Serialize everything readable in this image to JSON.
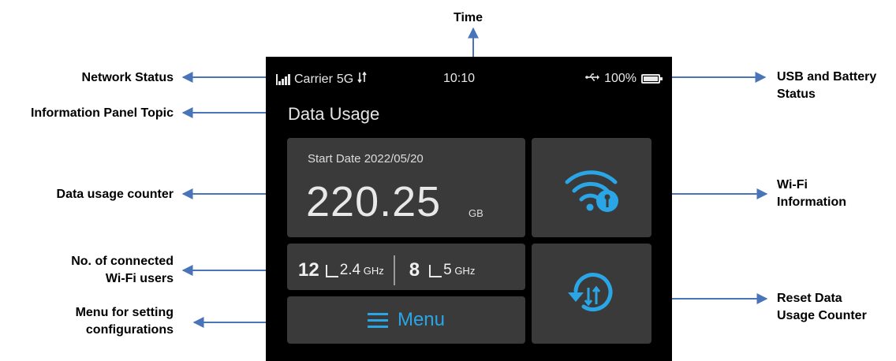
{
  "callouts": {
    "time": "Time",
    "network_status": "Network Status",
    "info_panel_topic": "Information Panel Topic",
    "data_usage_counter": "Data usage counter",
    "connected_users_line1": "No. of connected",
    "connected_users_line2": "Wi-Fi users",
    "menu_line1": "Menu for setting",
    "menu_line2": "configurations",
    "usb_battery_line1": "USB and Battery",
    "usb_battery_line2": "Status",
    "wifi_info_line1": "Wi-Fi",
    "wifi_info_line2": "Information",
    "reset_line1": "Reset Data",
    "reset_line2": "Usage Counter"
  },
  "status_bar": {
    "carrier": "Carrier",
    "network_type": "5G",
    "time": "10:10",
    "battery_percent": "100%",
    "icons": [
      "signal-icon",
      "data-transfer-icon",
      "usb-icon",
      "battery-icon"
    ]
  },
  "panel": {
    "title": "Data Usage"
  },
  "usage": {
    "start_date": "Start Date 2022/05/20",
    "value": "220.25",
    "unit": "GB"
  },
  "users": {
    "band1_count": "12",
    "band1_label": "2.4",
    "band1_unit": "GHz",
    "band2_count": "8",
    "band2_label": "5",
    "band2_unit": "GHz"
  },
  "menu": {
    "label": "Menu"
  },
  "colors": {
    "accent": "#2aa6e6",
    "arrow": "#4a74b8",
    "tile": "#3a3a3a",
    "screen": "#000000"
  }
}
